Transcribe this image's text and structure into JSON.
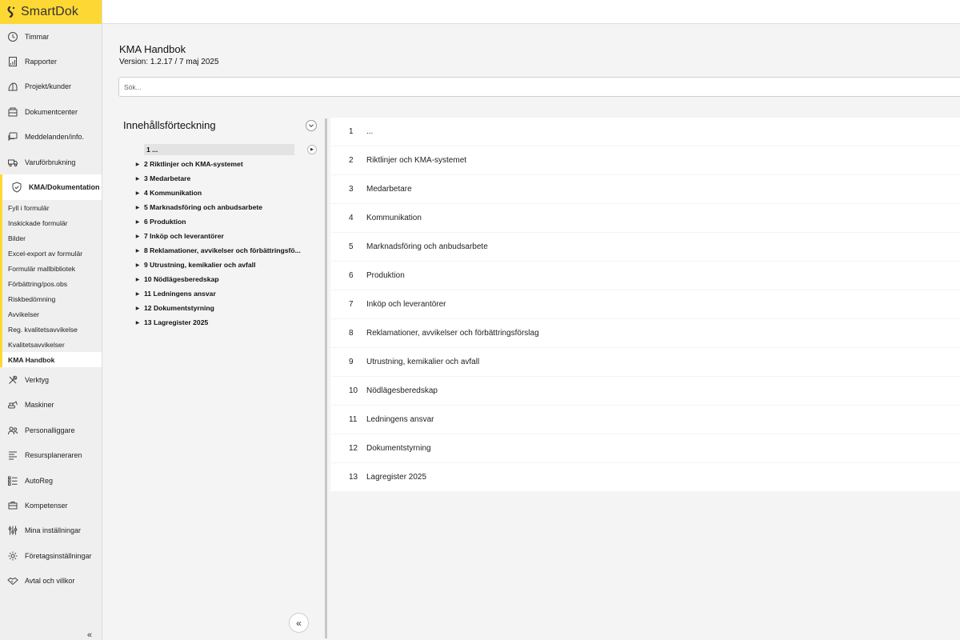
{
  "app": {
    "name": "SmartDok"
  },
  "sidebar": {
    "items_top": [
      {
        "label": "Timmar",
        "icon": "clock-icon"
      },
      {
        "label": "Rapporter",
        "icon": "report-icon"
      },
      {
        "label": "Projekt/kunder",
        "icon": "project-icon"
      },
      {
        "label": "Dokumentcenter",
        "icon": "document-icon"
      },
      {
        "label": "Meddelanden/info.",
        "icon": "message-icon"
      },
      {
        "label": "Varuförbrukning",
        "icon": "truck-icon"
      }
    ],
    "active_item": {
      "label": "KMA/Dokumentation",
      "icon": "shield-icon"
    },
    "sub_items": [
      "Fyll i formulär",
      "Inskickade formulär",
      "Bilder",
      "Excel-export av formulär",
      "Formulär mallbibliotek",
      "Förbättring/pos.obs",
      "Riskbedömning",
      "Avvikelser",
      "Reg. kvalitetsavvikelse",
      "Kvalitetsavvikelser",
      "KMA Handbok"
    ],
    "active_sub": "KMA Handbok",
    "items_bottom": [
      {
        "label": "Verktyg",
        "icon": "tools-icon"
      },
      {
        "label": "Maskiner",
        "icon": "excavator-icon"
      },
      {
        "label": "Personalliggare",
        "icon": "people-icon"
      },
      {
        "label": "Resursplaneraren",
        "icon": "planner-icon"
      },
      {
        "label": "AutoReg",
        "icon": "list-icon"
      },
      {
        "label": "Kompetenser",
        "icon": "competence-icon"
      },
      {
        "label": "Mina inställningar",
        "icon": "sliders-icon"
      },
      {
        "label": "Företagsinställningar",
        "icon": "gear-icon"
      },
      {
        "label": "Avtal och villkor",
        "icon": "handshake-icon"
      }
    ],
    "collapse_glyph": "«"
  },
  "header": {
    "title": "KMA Handbok",
    "version": "Version: 1.2.17 / 7 maj 2025"
  },
  "search": {
    "placeholder": "Sök..."
  },
  "toc": {
    "title": "Innehållsförteckning",
    "items": [
      {
        "label": "1 ...",
        "expandable": false,
        "active": true
      },
      {
        "label": "2 Riktlinjer och KMA-systemet",
        "expandable": true
      },
      {
        "label": "3 Medarbetare",
        "expandable": true
      },
      {
        "label": "4 Kommunikation",
        "expandable": true
      },
      {
        "label": "5 Marknadsföring och anbudsarbete",
        "expandable": true
      },
      {
        "label": "6 Produktion",
        "expandable": true
      },
      {
        "label": "7 Inköp och leverantörer",
        "expandable": true
      },
      {
        "label": "8 Reklamationer, avvikelser och förbättringsfö...",
        "expandable": true
      },
      {
        "label": "9 Utrustning, kemikalier och avfall",
        "expandable": true
      },
      {
        "label": "10 Nödlägesberedskap",
        "expandable": true
      },
      {
        "label": "11 Ledningens ansvar",
        "expandable": true
      },
      {
        "label": "12 Dokumentstyrning",
        "expandable": true
      },
      {
        "label": "13 Lagregister 2025",
        "expandable": true
      }
    ],
    "collapse_glyph": "«"
  },
  "content": {
    "rows": [
      {
        "num": "1",
        "text": "..."
      },
      {
        "num": "2",
        "text": "Riktlinjer och KMA-systemet"
      },
      {
        "num": "3",
        "text": "Medarbetare"
      },
      {
        "num": "4",
        "text": "Kommunikation"
      },
      {
        "num": "5",
        "text": "Marknadsföring och anbudsarbete"
      },
      {
        "num": "6",
        "text": "Produktion"
      },
      {
        "num": "7",
        "text": "Inköp och leverantörer"
      },
      {
        "num": "8",
        "text": "Reklamationer, avvikelser och förbättringsförslag"
      },
      {
        "num": "9",
        "text": "Utrustning, kemikalier och avfall"
      },
      {
        "num": "10",
        "text": "Nödlägesberedskap"
      },
      {
        "num": "11",
        "text": "Ledningens ansvar"
      },
      {
        "num": "12",
        "text": "Dokumentstyrning"
      },
      {
        "num": "13",
        "text": "Lagregister 2025"
      }
    ]
  },
  "colors": {
    "accent": "#fdd835",
    "sidebar_bg": "#efefef",
    "page_bg": "#f4f4f4"
  }
}
